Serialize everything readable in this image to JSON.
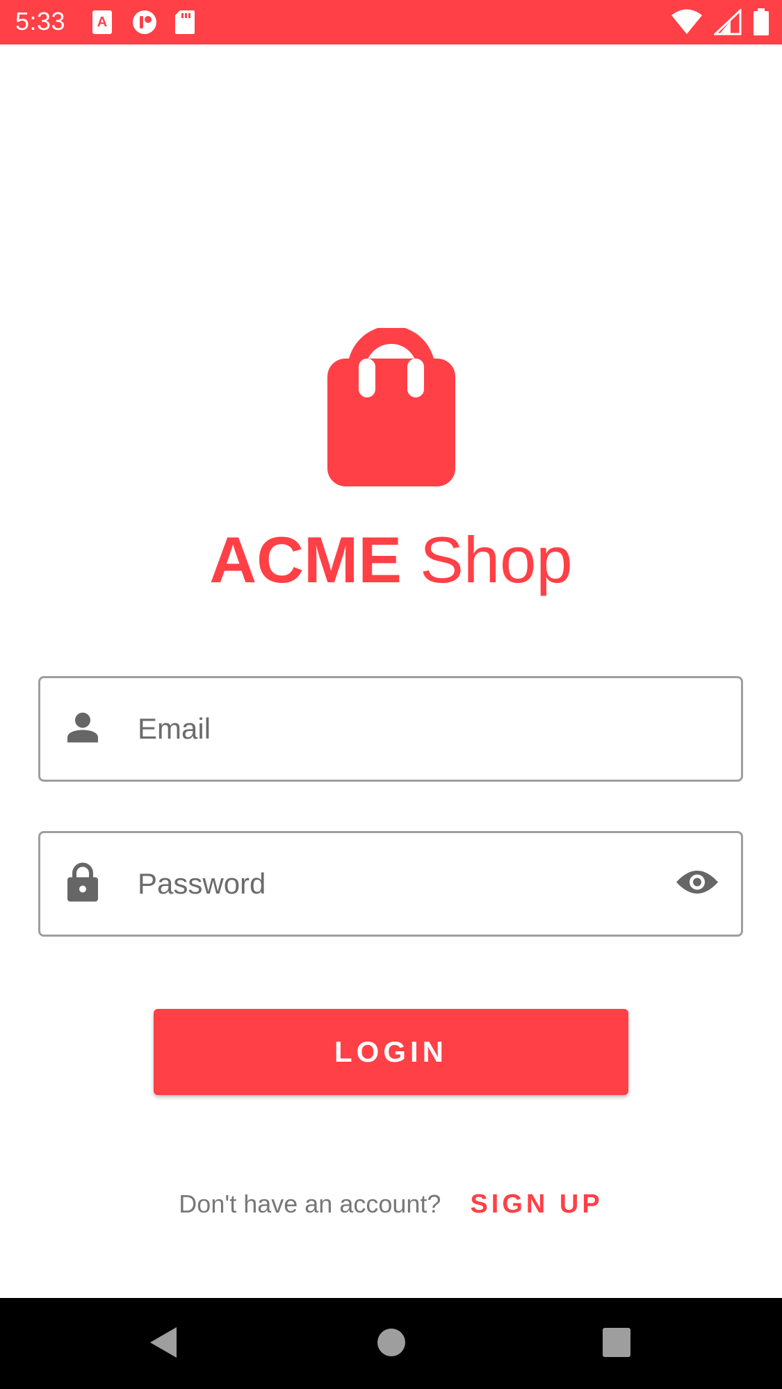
{
  "status_bar": {
    "time": "5:33",
    "background": "#ff4046",
    "left_icons": [
      "text-a-icon",
      "app-badge-icon",
      "sd-card-icon"
    ],
    "right_icons": [
      "wifi-icon",
      "signal-icon",
      "battery-icon"
    ]
  },
  "brand": {
    "logo_icon": "shopping-bag-icon",
    "name_bold": "ACME",
    "name_light": "Shop",
    "color": "#ff4046"
  },
  "form": {
    "email": {
      "placeholder": "Email",
      "value": "",
      "icon": "person-icon"
    },
    "password": {
      "placeholder": "Password",
      "value": "",
      "icon": "lock-icon",
      "toggle_icon": "eye-icon"
    },
    "login_label": "LOGIN"
  },
  "signup": {
    "prompt": "Don't have an account?",
    "link_label": "SIGN UP"
  },
  "nav_bar": {
    "buttons": [
      "back-icon",
      "home-icon",
      "recents-icon"
    ]
  }
}
